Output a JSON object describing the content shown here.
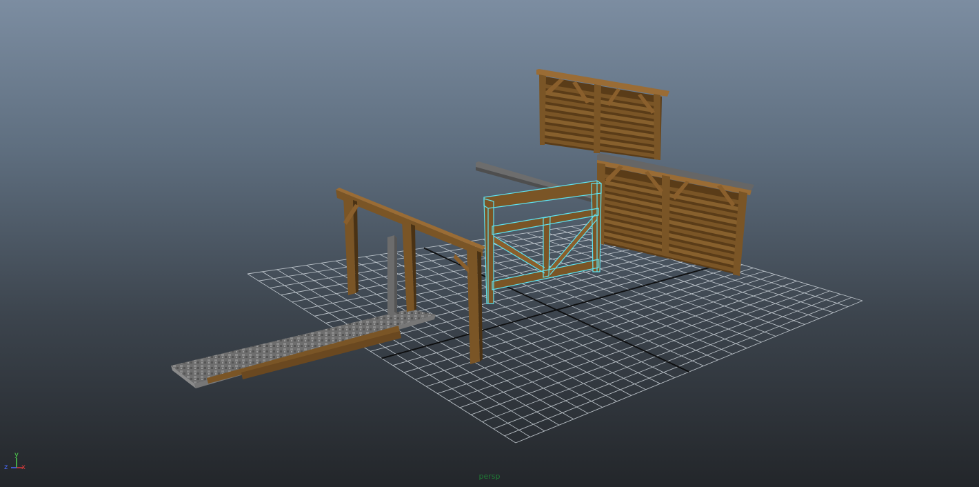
{
  "viewport": {
    "camera_name": "persp"
  },
  "axis_gizmo": {
    "y_label": "y",
    "x_label": "x",
    "z_label": "z",
    "colors": {
      "x": "#d63b3b",
      "y": "#4fd14f",
      "z": "#4a6bff"
    }
  },
  "scene": {
    "objects": [
      {
        "name": "upper-wall-panel",
        "material": "wood"
      },
      {
        "name": "right-wall-panel",
        "material": "wood"
      },
      {
        "name": "gate-frame",
        "material": "wood",
        "selected": true
      },
      {
        "name": "gallows-frame",
        "material": "wood"
      },
      {
        "name": "stone-ramp",
        "material": "stone"
      },
      {
        "name": "stone-post",
        "material": "stone"
      },
      {
        "name": "stone-beam",
        "material": "stone"
      }
    ],
    "colors": {
      "wood": "#7a5526",
      "wood_dark": "#4a3214",
      "wood_light": "#9a6c35",
      "stone": "#6f6f6f",
      "selection": "#5fe3f0",
      "grid": "#cfd6dc"
    }
  }
}
